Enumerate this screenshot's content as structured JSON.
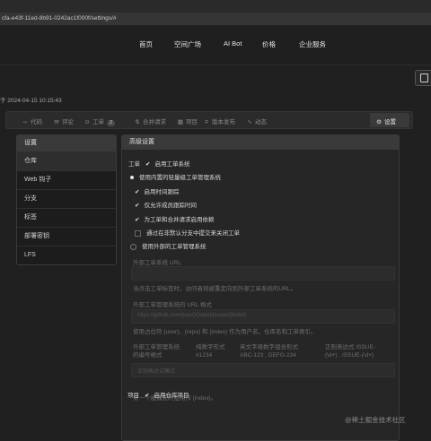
{
  "browser": {
    "address": "cfa-e43f-11ed-8b91-0242ac1f000f/settings/#"
  },
  "navbar": {
    "items": [
      "首页",
      "空间广场",
      "AI Bot",
      "价格",
      "企业服务"
    ]
  },
  "meta": {
    "text": "于 2024-04-15 10:15:43"
  },
  "tabs": {
    "items": [
      {
        "icon": "‹›",
        "label": "代码"
      },
      {
        "icon": "✉",
        "label": "评论"
      },
      {
        "icon": "⊙",
        "label": "工单",
        "badge": "2"
      },
      {
        "icon": "⇅",
        "label": "合并请求"
      },
      {
        "icon": "▦",
        "label": "项目"
      },
      {
        "icon": "⌗",
        "label": "版本发布"
      },
      {
        "icon": "∿",
        "label": "动态"
      }
    ],
    "active": {
      "icon": "⚙",
      "label": "设置"
    }
  },
  "sidebar": {
    "title": "设置",
    "items": [
      "仓库",
      "Web 钩子",
      "分支",
      "标签",
      "部署密钥",
      "LFS"
    ]
  },
  "panel": {
    "title": "高级设置",
    "issue_section_label": "工单",
    "enable_issues": "启用工单系统",
    "internal_tracker": "使用内置的轻量级工单管理系统",
    "enable_timetracker": "启用时间跟踪",
    "only_contributors": "仅允许成员跟踪时间",
    "enable_deps": "为工单和合并请求启用依赖",
    "allow_close_commits": "通过在非默认分支中提交来关闭工单",
    "external_tracker": "使用外部的工单管理系统",
    "ext_url_label": "外部工单系统 URL",
    "ext_url_help": "当点击工单标签时，访问者将被重定向到外部工单系统的URL。",
    "ext_format_label": "外部工单管理系统的 URL 格式",
    "ext_format_placeholder": "https://github.com/{user}/{repo}/issues/{index}",
    "ext_format_help": "使用占位符 {user}、{repo} 和 {index} 作为用户名、仓库名和工单索引。",
    "style_label": "外部工单管理系统的编号格式",
    "style_numeric": "纯数字形式",
    "style_numeric_ex": "#1234",
    "style_alpha": "英文字母数字组合形式",
    "style_alpha_ex": "ABC-123 , DEFG-234",
    "style_regex": "正则表达式",
    "style_regex_ex_a": "ISSUE-",
    "style_regex_ex_b": "(\\d+) , ISSUE-(\\d+)",
    "regex_placeholder": "正则表达式模式",
    "regex_help": "第一个被捕获的组用作 {index}。",
    "project_section_label": "项目",
    "enable_projects": "启用仓库项目"
  },
  "watermark": "@稀土掘金技术社区"
}
